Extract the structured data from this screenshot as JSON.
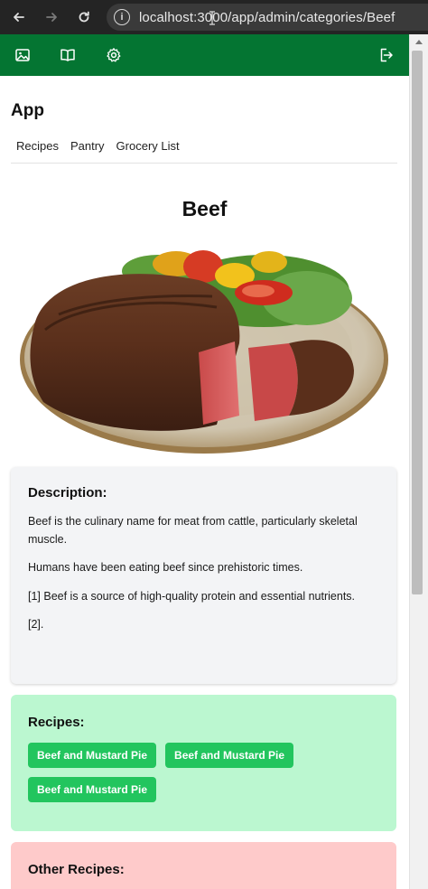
{
  "browser": {
    "url": "localhost:3000/app/admin/categories/Beef",
    "info_icon": "i"
  },
  "header": {
    "icons": [
      "image-icon",
      "book-icon",
      "gear-icon",
      "logout-icon"
    ]
  },
  "app": {
    "title": "App",
    "nav": [
      "Recipes",
      "Pantry",
      "Grocery List"
    ]
  },
  "category": {
    "name": "Beef",
    "image_alt": "Beef steak with salad on a plate"
  },
  "description": {
    "heading": "Description:",
    "paragraphs": [
      "Beef is the culinary name for meat from cattle, particularly skeletal muscle.",
      "Humans have been eating beef since prehistoric times.",
      "[1] Beef is a source of high-quality protein and essential nutrients.",
      "[2]."
    ]
  },
  "recipes": {
    "heading": "Recipes:",
    "items": [
      "Beef and Mustard Pie",
      "Beef and Mustard Pie",
      "Beef and Mustard Pie"
    ]
  },
  "other_recipes": {
    "heading": "Other Recipes:"
  },
  "colors": {
    "header_green": "#047532",
    "recipes_bg": "#bbf7d0",
    "recipe_button": "#22c55e",
    "other_bg": "#fecaca",
    "description_bg": "#f3f4f6"
  }
}
